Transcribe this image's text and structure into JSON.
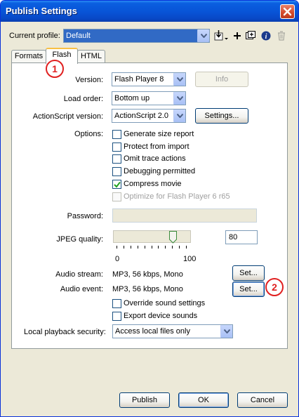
{
  "window": {
    "title": "Publish Settings"
  },
  "profile": {
    "label": "Current profile:",
    "value": "Default",
    "tool_icons": [
      "import-export-icon",
      "add-profile-icon",
      "duplicate-profile-icon",
      "profile-info-icon",
      "delete-profile-icon"
    ]
  },
  "tabs": [
    {
      "label": "Formats",
      "active": false
    },
    {
      "label": "Flash",
      "active": true
    },
    {
      "label": "HTML",
      "active": false
    }
  ],
  "flash": {
    "version_label": "Version:",
    "version_value": "Flash Player 8",
    "info_button": "Info",
    "load_order_label": "Load order:",
    "load_order_value": "Bottom up",
    "as_version_label": "ActionScript version:",
    "as_version_value": "ActionScript 2.0",
    "settings_button": "Settings...",
    "options_label": "Options:",
    "options": [
      {
        "label": "Generate size report",
        "checked": false,
        "enabled": true
      },
      {
        "label": "Protect from import",
        "checked": false,
        "enabled": true
      },
      {
        "label": "Omit trace actions",
        "checked": false,
        "enabled": true
      },
      {
        "label": "Debugging permitted",
        "checked": false,
        "enabled": true
      },
      {
        "label": "Compress movie",
        "checked": true,
        "enabled": true
      },
      {
        "label": "Optimize for Flash Player 6 r65",
        "checked": false,
        "enabled": false
      }
    ],
    "password_label": "Password:",
    "password_value": "",
    "jpeg_label": "JPEG quality:",
    "jpeg_value": "80",
    "jpeg_min_label": "0",
    "jpeg_max_label": "100",
    "jpeg_slider_fraction": 0.8,
    "audio_stream_label": "Audio stream:",
    "audio_stream_value": "MP3, 56 kbps, Mono",
    "audio_stream_button": "Set...",
    "audio_event_label": "Audio event:",
    "audio_event_value": "MP3, 56 kbps, Mono",
    "audio_event_button": "Set...",
    "sound_options": [
      {
        "label": "Override sound settings",
        "checked": false
      },
      {
        "label": "Export device sounds",
        "checked": false
      }
    ],
    "security_label": "Local playback security:",
    "security_value": "Access local files only"
  },
  "footer": {
    "publish": "Publish",
    "ok": "OK",
    "cancel": "Cancel"
  },
  "callouts": [
    "1",
    "2"
  ],
  "colors": {
    "title_bar": "#0853d6",
    "active_tab_accent": "#f9c044",
    "callout": "#e02020",
    "dialog_bg": "#ece9d8"
  }
}
